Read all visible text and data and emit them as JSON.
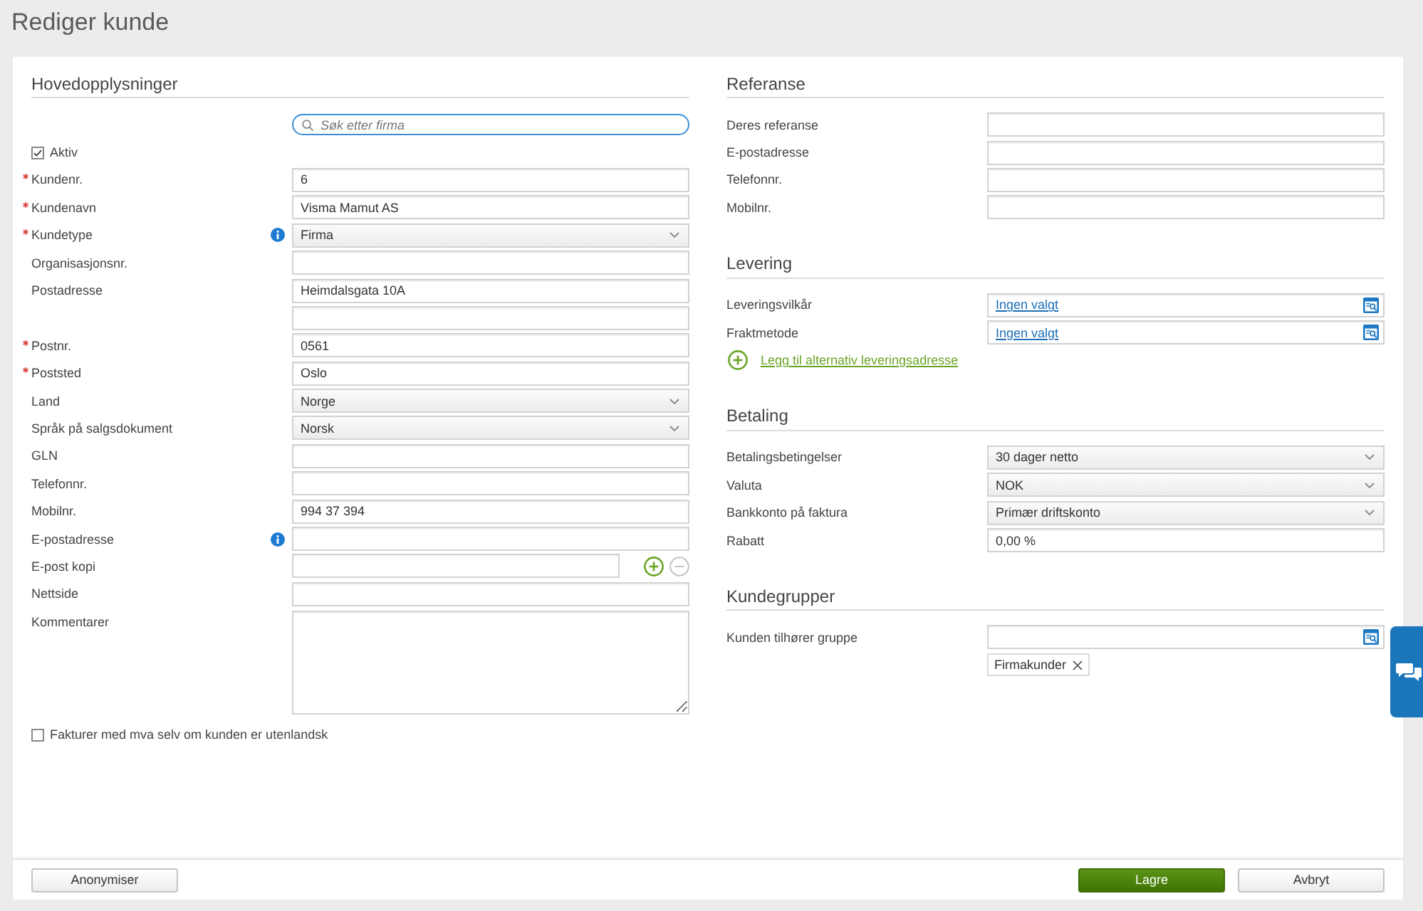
{
  "page": {
    "title": "Rediger kunde"
  },
  "main": {
    "heading": "Hovedopplysninger",
    "search": {
      "placeholder": "Søk etter firma",
      "focused": true
    },
    "fields": [
      {
        "kind": "checkbox",
        "label": "Aktiv",
        "checked": true
      },
      {
        "kind": "text",
        "label": "Kundenr.",
        "value": "6",
        "required": true,
        "info": false
      },
      {
        "kind": "text",
        "label": "Kundenavn",
        "value": "Visma Mamut AS",
        "required": true,
        "info": false
      },
      {
        "kind": "select",
        "label": "Kundetype",
        "value": "Firma",
        "required": true,
        "info": true
      },
      {
        "kind": "text",
        "label": "Organisasjonsnr.",
        "required": false,
        "info": false
      },
      {
        "kind": "text",
        "label": "Postadresse",
        "value": "Heimdalsgata 10A",
        "required": false,
        "info": false
      },
      {
        "kind": "text",
        "required": false,
        "info": false
      },
      {
        "kind": "text",
        "label": "Postnr.",
        "value": "0561",
        "required": true,
        "info": false
      },
      {
        "kind": "text",
        "label": "Poststed",
        "value": "Oslo",
        "required": true,
        "info": false
      },
      {
        "kind": "select",
        "label": "Land",
        "value": "Norge",
        "required": false,
        "info": false
      },
      {
        "kind": "select",
        "label": "Språk på salgsdokument",
        "value": "Norsk",
        "required": false,
        "info": false
      },
      {
        "kind": "text",
        "label": "GLN",
        "required": false,
        "info": false
      },
      {
        "kind": "text",
        "label": "Telefonnr.",
        "required": false,
        "info": false
      },
      {
        "kind": "text",
        "label": "Mobilnr.",
        "value": "994 37 394",
        "required": false,
        "info": false
      },
      {
        "kind": "text",
        "label": "E-postadresse",
        "required": false,
        "info": true
      },
      {
        "kind": "email_list",
        "label": "E-post kopi",
        "required": false,
        "info": false,
        "remove_disabled": true
      },
      {
        "kind": "text",
        "label": "Nettside",
        "required": false,
        "info": false
      },
      {
        "kind": "textarea",
        "label": "Kommentarer",
        "required": false,
        "info": false
      },
      {
        "kind": "checkbox",
        "label": "Fakturer med mva selv om kunden er utenlandsk",
        "checked": false
      }
    ]
  },
  "sections": [
    {
      "heading": "Referanse",
      "fields": [
        {
          "kind": "text",
          "label": "Deres referanse"
        },
        {
          "kind": "text",
          "label": "E-postadresse"
        },
        {
          "kind": "text",
          "label": "Telefonnr."
        },
        {
          "kind": "text",
          "label": "Mobilnr."
        }
      ]
    },
    {
      "heading": "Levering",
      "fields": [
        {
          "kind": "lookup",
          "label": "Leveringsvilkår",
          "link": "Ingen valgt"
        },
        {
          "kind": "lookup",
          "label": "Fraktmetode",
          "link": "Ingen valgt"
        },
        {
          "kind": "add_link",
          "label": "Legg til alternativ leveringsadresse"
        }
      ]
    },
    {
      "heading": "Betaling",
      "fields": [
        {
          "kind": "select",
          "label": "Betalingsbetingelser",
          "value": "30 dager netto"
        },
        {
          "kind": "select",
          "label": "Valuta",
          "value": "NOK"
        },
        {
          "kind": "select",
          "label": "Bankkonto på faktura",
          "value": "Primær driftskonto"
        },
        {
          "kind": "text",
          "label": "Rabatt",
          "value": "0,00 %"
        }
      ]
    },
    {
      "heading": "Kundegrupper",
      "fields": [
        {
          "kind": "lookup",
          "label": "Kunden tilhører gruppe",
          "tags": [
            {
              "label": "Firmakunder"
            }
          ]
        }
      ]
    }
  ],
  "footer": {
    "left_buttons": [
      {
        "label": "Anonymiser",
        "kind": "secondary"
      }
    ],
    "right_buttons": [
      {
        "label": "Lagre",
        "kind": "primary"
      },
      {
        "label": "Avbryt",
        "kind": "secondary"
      }
    ]
  }
}
